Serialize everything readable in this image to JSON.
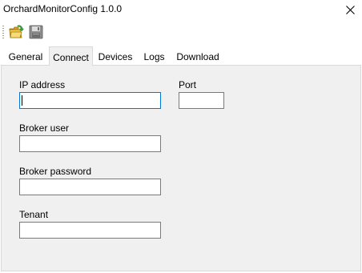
{
  "window": {
    "title": "OrchardMonitorConfig 1.0.0"
  },
  "toolbar": {
    "open_icon": "folder-open-icon",
    "save_icon": "save-disk-icon"
  },
  "tabs": [
    {
      "label": "General",
      "active": false
    },
    {
      "label": "Connect",
      "active": true
    },
    {
      "label": "Devices",
      "active": false
    },
    {
      "label": "Logs",
      "active": false
    },
    {
      "label": "Download",
      "active": false
    }
  ],
  "connect": {
    "ip_label": "IP address",
    "ip_value": "",
    "port_label": "Port",
    "port_value": "",
    "broker_user_label": "Broker user",
    "broker_user_value": "",
    "broker_password_label": "Broker password",
    "broker_password_value": "",
    "tenant_label": "Tenant",
    "tenant_value": ""
  },
  "colors": {
    "panel_bg": "#f0f0f0",
    "focus_border": "#0078d7",
    "field_border": "#7a7a7a"
  }
}
